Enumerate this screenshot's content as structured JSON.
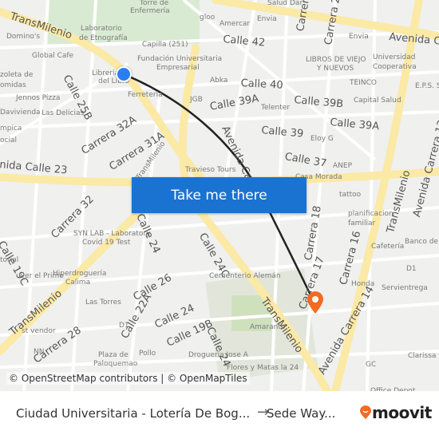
{
  "map": {
    "labels": [
      "TransMilenio",
      "Torre de",
      "Enfermería",
      "Laboratorio",
      "de Etnografía",
      "Domino's",
      "Global Cafe",
      "Capilla (251)",
      "Fundación Universitaria",
      "Empresarial",
      "Librería",
      "del Libro",
      "Ferretería",
      "zoleta de",
      "omidas",
      "Jennos Pizza",
      "Davivienda",
      "Las Delicias",
      "Calle 25B",
      "Carrera 32A",
      "Carrera 31A",
      "TransMilenio",
      "mpica",
      "ocial",
      "nida Calle 23",
      "Travieso Tours",
      "gloo",
      "Amercar",
      "Envia",
      "Salud Dar",
      "Calle 42",
      "Carrera",
      "Carrera 20",
      "Envia",
      "Avenida Calle",
      "LIBROS DE VIEJO",
      "Y NUEVOS",
      "Universidad",
      "Cooperativa",
      "Abka",
      "Calle 40",
      "TEINCO",
      "E.P.S. Sánitas",
      "JGB",
      "Calle 39A",
      "Telenter",
      "Calle 39B",
      "Capital Salud",
      "Avenida Calle 27",
      "Calle 39",
      "Calle 39A",
      "Eloy G",
      "Calle 37",
      "ANEP",
      "Casa Morada",
      "tattoo",
      "planificacion",
      "familiar",
      "Carrera 18",
      "Carrera 16",
      "Carrera 17",
      "TransMilenio",
      "Avenida Carrera 13",
      "Carrera 32",
      "Calle 19C",
      "SYN LAB - Laboratory",
      "Covid 19 Test",
      "Calle 24",
      "Calle 24C",
      "Hiperdroguería",
      "Calima",
      "uver el Primo",
      "Las Torres",
      "Calle 26",
      "Cementerio Alemán",
      "Calle 24",
      "Calle 19B",
      "Calle 22A",
      "D1",
      "TransMilenio",
      "st vendor",
      "Carrera 28",
      "NN",
      "Plaza de",
      "Paloquemao",
      "Pollo",
      "Droguería Jose A",
      "Amaranto",
      "Calle 24",
      "Avenida Carrera 14",
      "TransMilenio",
      "Cafetería",
      "Banco de",
      "Honda",
      "Servientrega",
      "D1",
      "Clarissa",
      "GC",
      "Office Depot",
      "Flores y Matas la 24",
      "torial"
    ],
    "attribution": "© OpenStreetMap contributors | © OpenMapTiles",
    "take_me_there": "Take me there",
    "colors": {
      "button": "#1a73d1",
      "route": "#222222",
      "origin": "#2a7ef0",
      "destination": "#f26b21",
      "major_road": "#fbe9a6"
    }
  },
  "footer": {
    "from": "Ciudad Universitaria - Lotería De Bog...",
    "arrow": "→",
    "to": "Sede Way...",
    "brand": "moovit"
  }
}
